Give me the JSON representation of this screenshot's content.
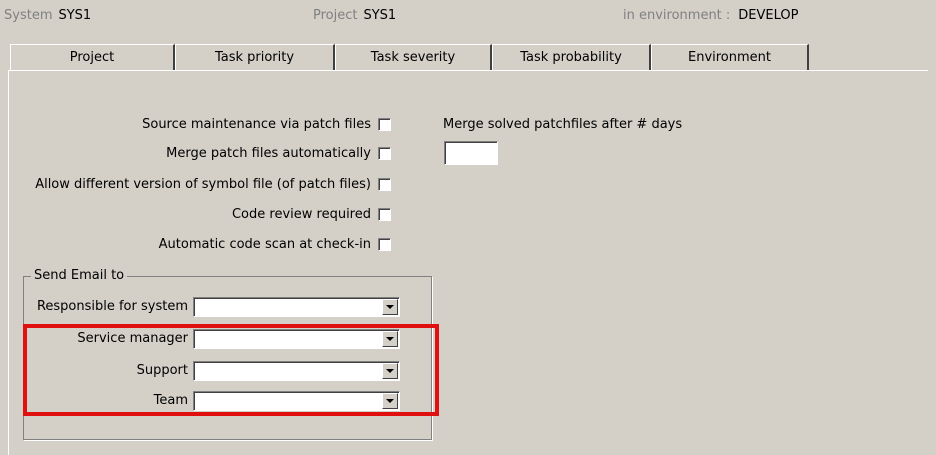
{
  "header": {
    "system_label": "System",
    "system_value": "SYS1",
    "project_label": "Project",
    "project_value": "SYS1",
    "env_label": "in environment :",
    "env_value": "DEVELOP"
  },
  "tabs": [
    {
      "label": "Project",
      "active": true
    },
    {
      "label": "Task priority",
      "active": false
    },
    {
      "label": "Task severity",
      "active": false
    },
    {
      "label": "Task probability",
      "active": false
    },
    {
      "label": "Environment",
      "active": false
    }
  ],
  "options": [
    {
      "label": "Source maintenance via patch files",
      "checked": false
    },
    {
      "label": "Merge patch files automatically",
      "checked": false
    },
    {
      "label": "Allow different version of symbol file (of patch files)",
      "checked": false
    },
    {
      "label": "Code review required",
      "checked": false
    },
    {
      "label": "Automatic code scan at check-in",
      "checked": false
    }
  ],
  "merge_days": {
    "label": "Merge solved patchfiles after # days",
    "value": ""
  },
  "email": {
    "group_title": "Send Email to",
    "fields": [
      {
        "label": "Responsible for system",
        "value": ""
      },
      {
        "label": "Service manager",
        "value": ""
      },
      {
        "label": "Support",
        "value": ""
      },
      {
        "label": "Team",
        "value": ""
      }
    ]
  },
  "colors": {
    "background": "#d4d0c8",
    "highlight": "#e01010"
  }
}
